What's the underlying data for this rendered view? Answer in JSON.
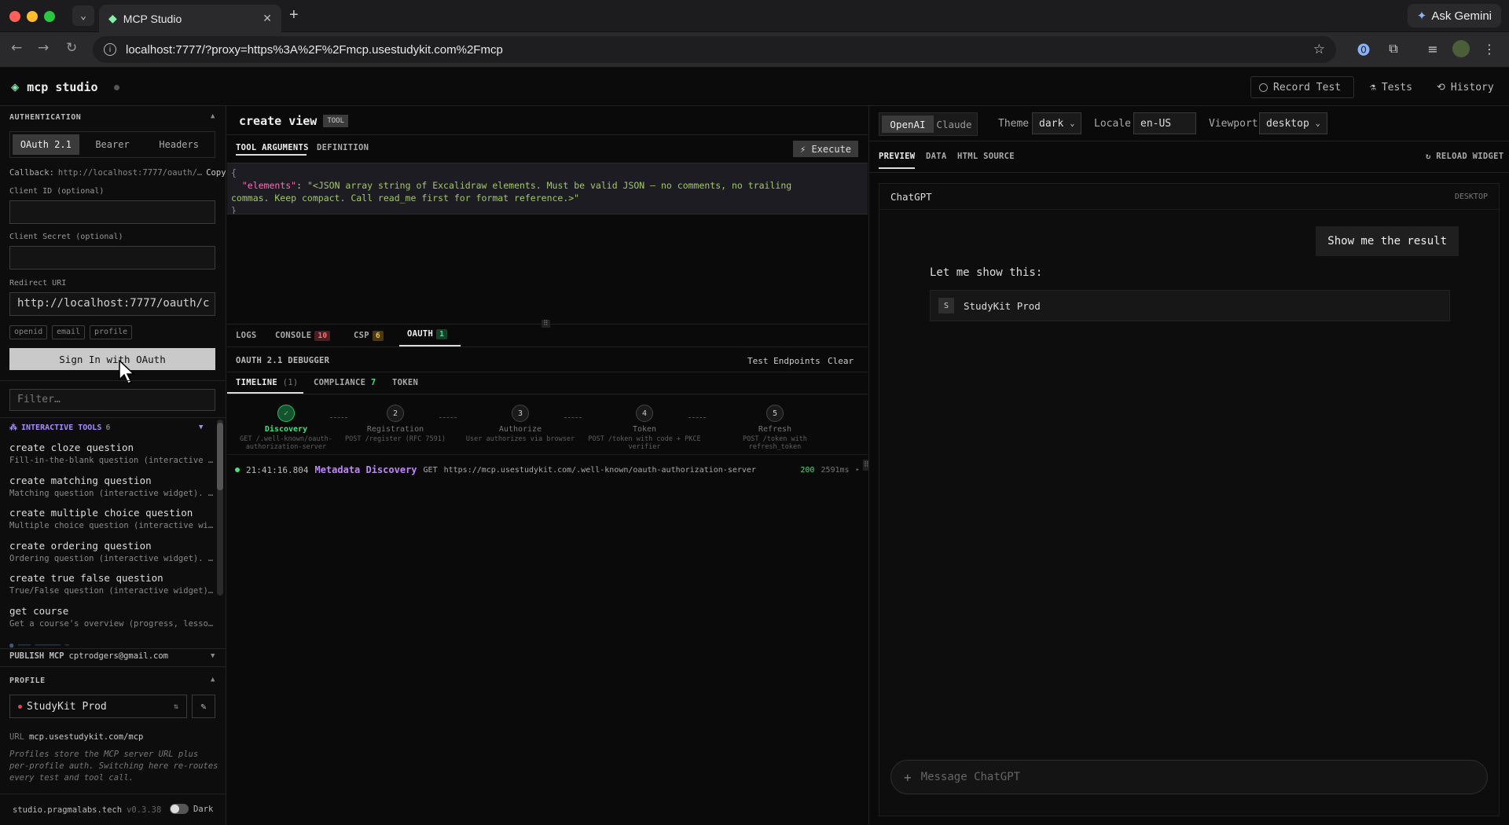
{
  "browser": {
    "tab_title": "MCP Studio",
    "url": "localhost:7777/?proxy=https%3A%2F%2Fmcp.usestudykit.com%2Fmcp",
    "ask_gemini": "Ask Gemini"
  },
  "header": {
    "app_name": "mcp studio",
    "record_test": "Record Test",
    "tests": "Tests",
    "history": "History"
  },
  "sidebar": {
    "auth_title": "AUTHENTICATION",
    "auth_tabs": [
      "OAuth 2.1",
      "Bearer",
      "Headers"
    ],
    "callback_label": "Callback:",
    "callback_url": "http://localhost:7777/oauth/…",
    "copy": "Copy",
    "client_id_label": "Client ID (optional)",
    "client_id_value": "",
    "client_secret_label": "Client Secret (optional)",
    "client_secret_value": "",
    "redirect_label": "Redirect URI",
    "redirect_value": "http://localhost:7777/oauth/c",
    "scopes": [
      "openid",
      "email",
      "profile"
    ],
    "sign_in": "Sign In with OAuth",
    "filter_placeholder": "Filter…",
    "tools_header": "INTERACTIVE TOOLS",
    "tools_count": "6",
    "tools": [
      {
        "title": "create cloze question",
        "desc": "Fill-in-the-blank question (interactive …"
      },
      {
        "title": "create matching question",
        "desc": "Matching question (interactive widget). …"
      },
      {
        "title": "create multiple choice question",
        "desc": "Multiple choice question (interactive wi…"
      },
      {
        "title": "create ordering question",
        "desc": "Ordering question (interactive widget). …"
      },
      {
        "title": "create true false question",
        "desc": "True/False question (interactive widget)…"
      },
      {
        "title": "get course",
        "desc": "Get a course's overview (progress, lesso…"
      }
    ],
    "publish_label": "PUBLISH MCP",
    "publish_email": "cptrodgers@gmail.com",
    "profile_title": "PROFILE",
    "profile_name": "StudyKit Prod",
    "url_label": "URL",
    "url_value": "mcp.usestudykit.com/mcp",
    "profile_note": "Profiles store the MCP server URL plus per-profile auth. Switching here re-routes every test and tool call.",
    "footer_site": "studio.pragmalabs.tech",
    "footer_version": "v0.3.38",
    "dark_label": "Dark"
  },
  "center": {
    "tool_name": "create view",
    "tool_badge": "TOOL",
    "tabs": [
      "TOOL ARGUMENTS",
      "DEFINITION"
    ],
    "execute": "⚡ Execute",
    "json_open": "{",
    "json_key": "\"elements\"",
    "json_value_1": "\"<JSON array string of Excalidraw elements. Must be valid JSON — no comments, no trailing",
    "json_value_2": "commas. Keep compact. Call read_me first for format reference.>\"",
    "json_close": "}",
    "log_tabs": {
      "logs": "LOGS",
      "console": "CONSOLE",
      "console_count": "10",
      "csp": "CSP",
      "csp_count": "6",
      "oauth": "OAUTH",
      "oauth_count": "1"
    },
    "debugger_title": "OAUTH 2.1 DEBUGGER",
    "test_endpoints": "Test Endpoints",
    "clear": "Clear",
    "sub_tabs": {
      "timeline": "TIMELINE",
      "timeline_count": "(1)",
      "compliance": "COMPLIANCE",
      "compliance_count": "7",
      "token": "TOKEN"
    },
    "steps": [
      {
        "num": "✓",
        "name": "Discovery",
        "sub": "GET /.well-known/oauth-authorization-server"
      },
      {
        "num": "2",
        "name": "Registration",
        "sub": "POST /register (RFC 7591)"
      },
      {
        "num": "3",
        "name": "Authorize",
        "sub": "User authorizes via browser"
      },
      {
        "num": "4",
        "name": "Token",
        "sub": "POST /token with code + PKCE verifier"
      },
      {
        "num": "5",
        "name": "Refresh",
        "sub": "POST /token with refresh_token"
      }
    ],
    "log_entry": {
      "time": "21:41:16.804",
      "name": "Metadata Discovery",
      "method": "GET",
      "url": "https://mcp.usestudykit.com/.well-known/oauth-authorization-server",
      "status": "200",
      "duration": "2591ms"
    }
  },
  "right": {
    "providers": [
      "OpenAI",
      "Claude"
    ],
    "theme_label": "Theme",
    "theme_value": "dark",
    "locale_label": "Locale",
    "locale_value": "en-US",
    "viewport_label": "Viewport",
    "viewport_value": "desktop",
    "tabs": [
      "PREVIEW",
      "DATA",
      "HTML SOURCE"
    ],
    "reload": "↻ RELOAD WIDGET",
    "chat_title": "ChatGPT",
    "chat_mode": "DESKTOP",
    "user_msg": "Show me the result",
    "assistant_msg": "Let me show this:",
    "widget_initial": "S",
    "widget_name": "StudyKit Prod",
    "composer_placeholder": "Message ChatGPT"
  },
  "colors": {
    "accent_green": "#4ade80",
    "accent_purple": "#c084fc",
    "badge_red": "#f87171",
    "badge_amber": "#fbbf24"
  }
}
